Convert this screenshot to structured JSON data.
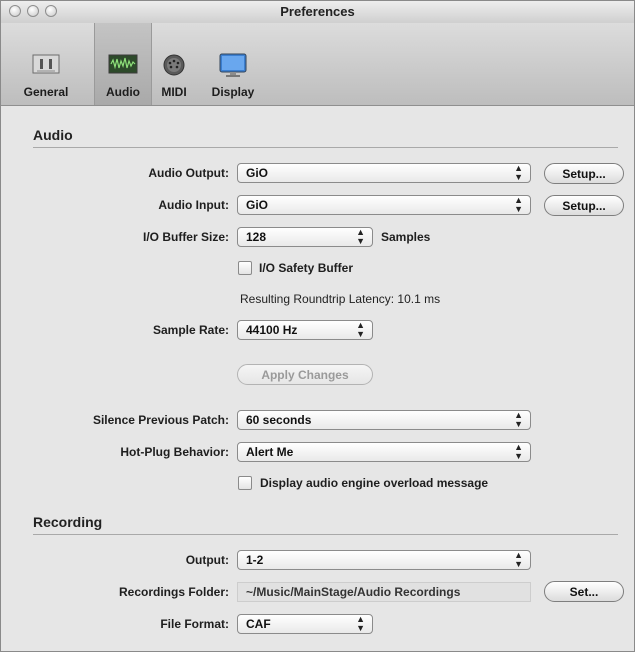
{
  "window": {
    "title": "Preferences"
  },
  "toolbar": {
    "items": [
      {
        "label": "General",
        "icon": "general-icon"
      },
      {
        "label": "Audio",
        "icon": "audio-waveform-icon"
      },
      {
        "label": "MIDI",
        "icon": "midi-connector-icon"
      },
      {
        "label": "Display",
        "icon": "display-monitor-icon"
      }
    ],
    "selected": "Audio"
  },
  "audio": {
    "heading": "Audio",
    "output_label": "Audio Output:",
    "output_value": "GiO",
    "input_label": "Audio Input:",
    "input_value": "GiO",
    "setup_label": "Setup...",
    "buffer_label": "I/O Buffer Size:",
    "buffer_value": "128",
    "buffer_unit": "Samples",
    "safety_label": "I/O Safety Buffer",
    "safety_checked": false,
    "latency_text": "Resulting Roundtrip Latency: 10.1 ms",
    "rate_label": "Sample Rate:",
    "rate_value": "44100 Hz",
    "apply_label": "Apply Changes",
    "silence_label": "Silence Previous Patch:",
    "silence_value": "60 seconds",
    "hotplug_label": "Hot-Plug Behavior:",
    "hotplug_value": "Alert Me",
    "overload_label": "Display audio engine overload message",
    "overload_checked": false
  },
  "recording": {
    "heading": "Recording",
    "output_label": "Output:",
    "output_value": "1-2",
    "folder_label": "Recordings Folder:",
    "folder_value": "~/Music/MainStage/Audio Recordings",
    "set_label": "Set...",
    "format_label": "File Format:",
    "format_value": "CAF"
  }
}
